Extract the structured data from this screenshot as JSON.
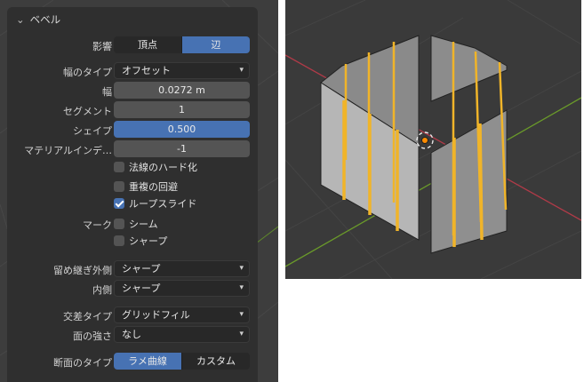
{
  "panel": {
    "title": "ベベル",
    "affect": {
      "label": "影響",
      "options": [
        "頂点",
        "辺"
      ],
      "selected": "辺"
    },
    "width_type": {
      "label": "幅のタイプ",
      "value": "オフセット"
    },
    "width": {
      "label": "幅",
      "value": "0.0272 m"
    },
    "segments": {
      "label": "セグメント",
      "value": "1"
    },
    "shape": {
      "label": "シェイプ",
      "value": "0.500"
    },
    "material_index": {
      "label": "マテリアルインデ…",
      "value": "-1"
    },
    "harden_normals": {
      "label": "法線のハード化",
      "checked": false
    },
    "clamp_overlap": {
      "label": "重複の回避",
      "checked": false
    },
    "loop_slide": {
      "label": "ループスライド",
      "checked": true
    },
    "mark": {
      "label": "マーク",
      "seam": {
        "label": "シーム",
        "checked": false
      },
      "sharp": {
        "label": "シャープ",
        "checked": false
      }
    },
    "miter_outer": {
      "label": "留め継ぎ外側",
      "value": "シャープ"
    },
    "miter_inner": {
      "label": "内側",
      "value": "シャープ"
    },
    "intersection_type": {
      "label": "交差タイプ",
      "value": "グリッドフィル"
    },
    "face_strength": {
      "label": "面の強さ",
      "value": "なし"
    },
    "profile_type": {
      "label": "断面のタイプ",
      "options": [
        "ラメ曲線",
        "カスタム"
      ],
      "selected": "ラメ曲線"
    }
  },
  "colors": {
    "accent": "#4772b3",
    "edge_selected": "#f0b429",
    "x_axis": "#b03a48",
    "y_axis": "#6a9a2a"
  },
  "icons": {
    "collapse": "chevron-down-icon",
    "dropdown": "chevron-down-icon",
    "origin": "object-origin-icon"
  }
}
